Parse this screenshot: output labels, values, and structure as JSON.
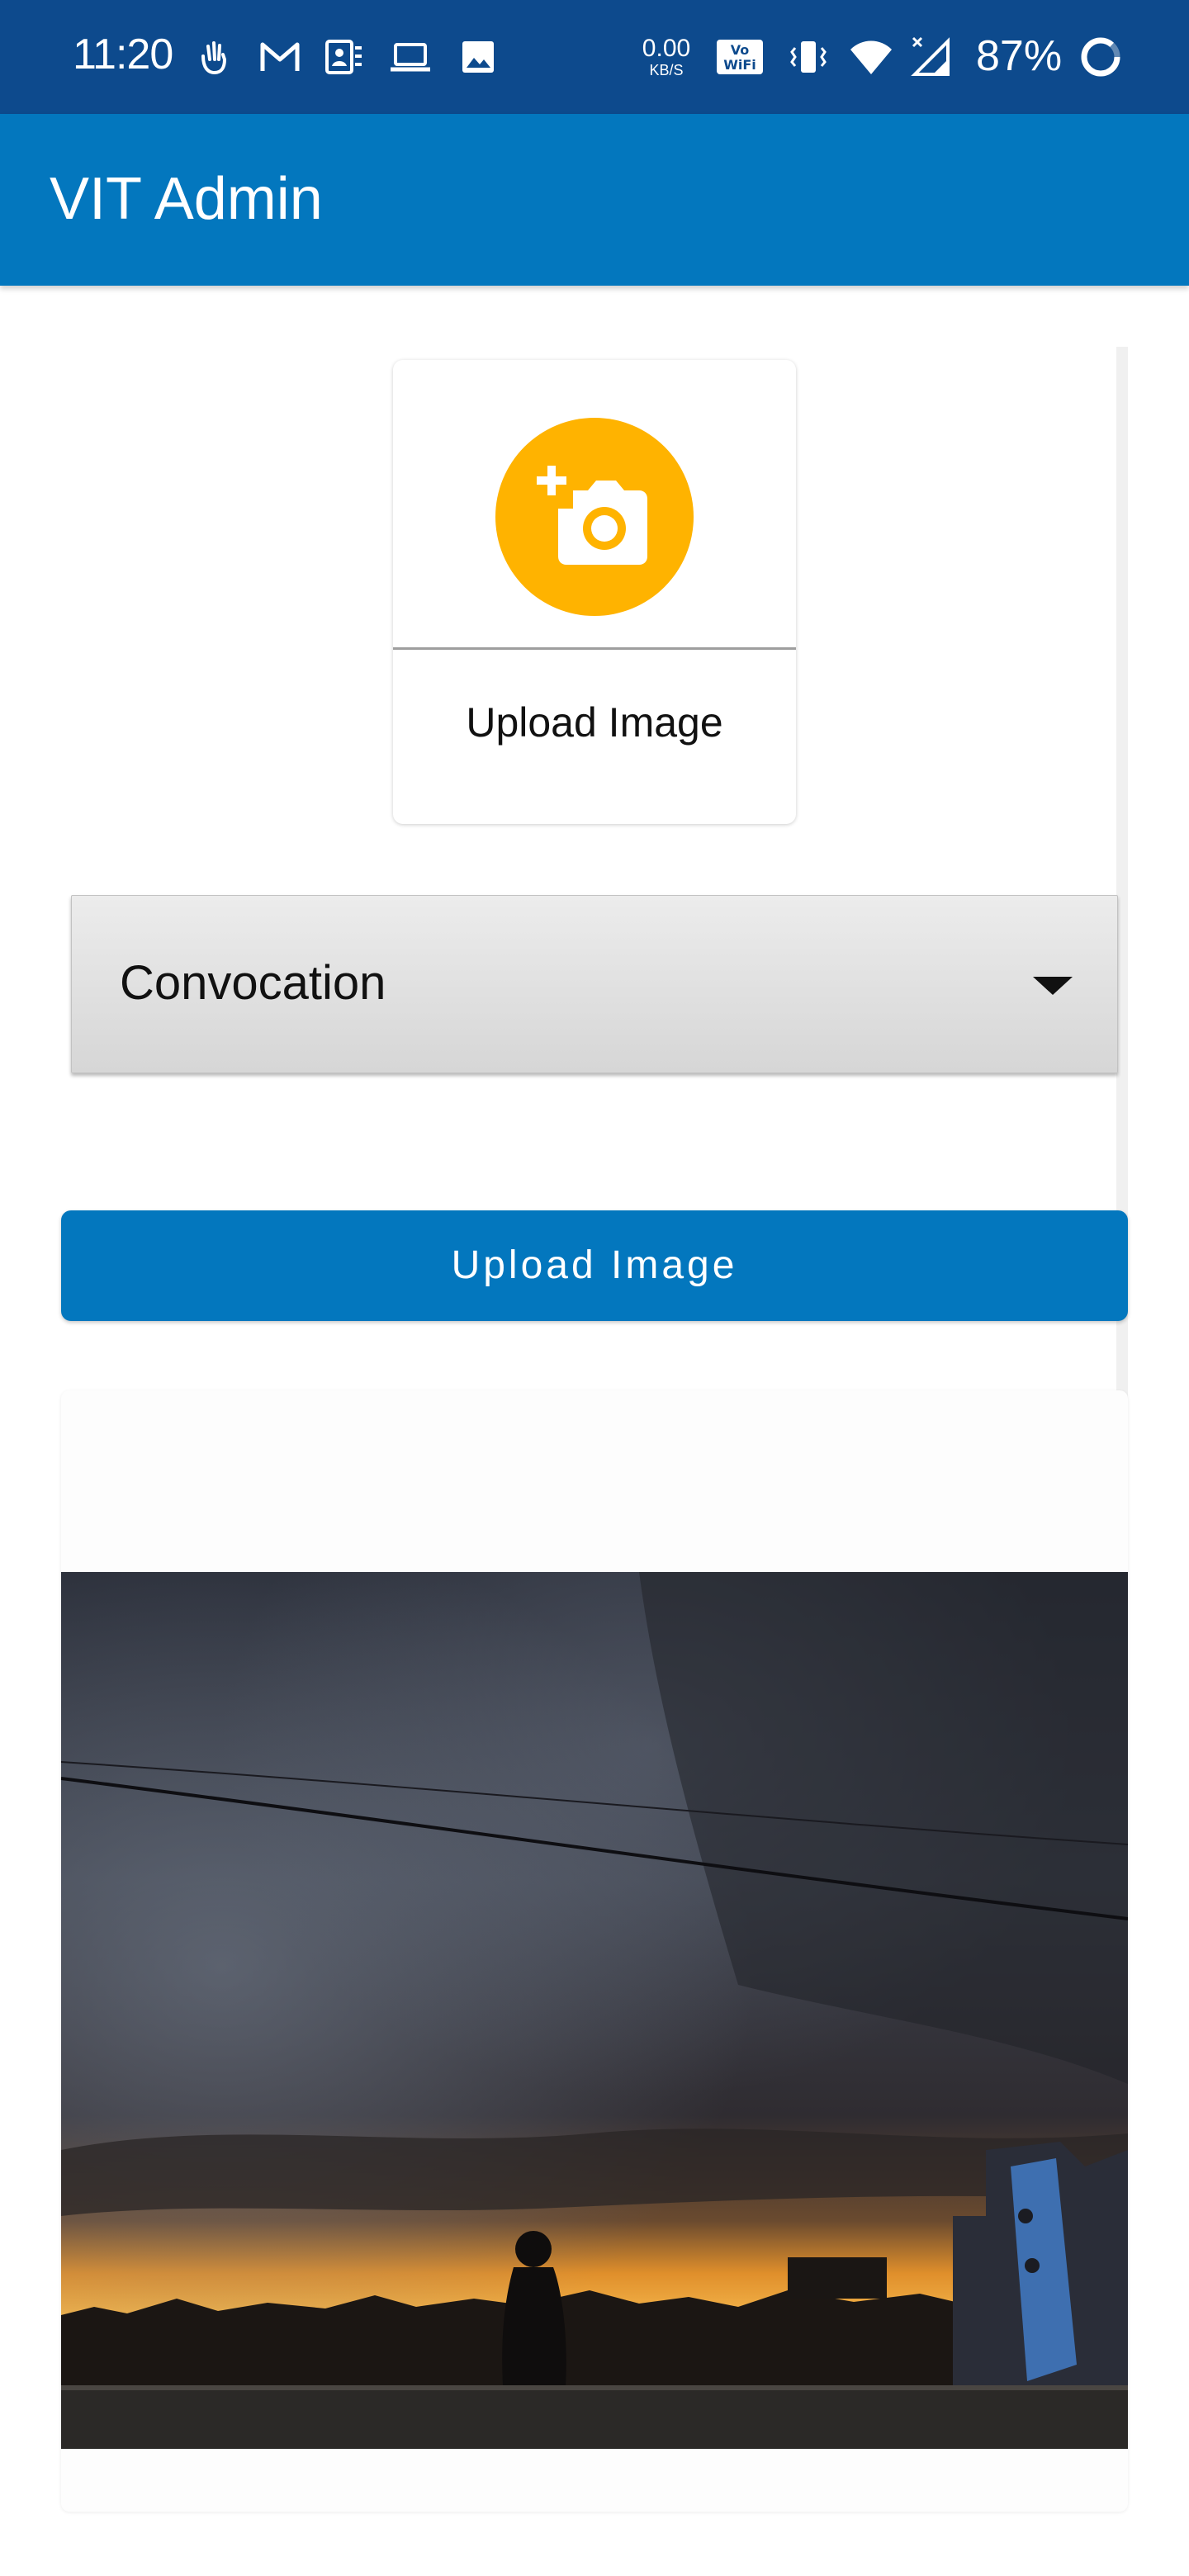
{
  "status_bar": {
    "time": "11:20",
    "net_speed_value": "0.00",
    "net_speed_unit": "KB/S",
    "battery": "87%",
    "icons": [
      "hand-icon",
      "gmail-icon",
      "contacts-icon",
      "laptop-icon",
      "image-icon",
      "vowifi-icon",
      "vibrate-icon",
      "wifi-icon",
      "signal-icon",
      "battery-ring-icon"
    ]
  },
  "app_bar": {
    "title": "VIT Admin"
  },
  "upload_card": {
    "label": "Upload Image",
    "icon": "add-a-photo-icon",
    "accent_color": "#FFB300"
  },
  "dropdown": {
    "selected": "Convocation"
  },
  "upload_button": {
    "label": "Upload Image"
  },
  "preview": {
    "content": "sunset photo with storm clouds and silhouetted person"
  },
  "colors": {
    "status_bar": "#0D4A8D",
    "app_bar": "#0377BE",
    "button": "#0377BE"
  }
}
